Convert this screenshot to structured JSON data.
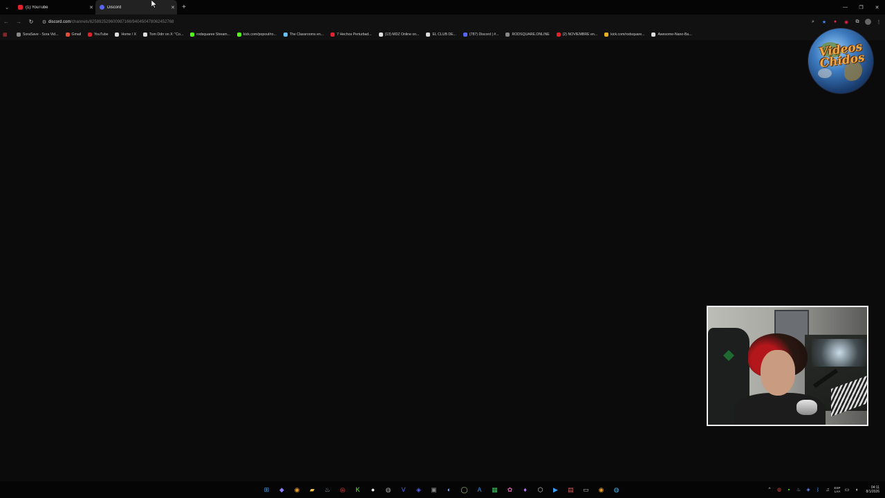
{
  "browser": {
    "tabs": [
      {
        "title": "(1) YouTube",
        "favicon": "youtube-icon",
        "active": false
      },
      {
        "title": "Discord",
        "favicon": "discord-icon",
        "active": true
      }
    ],
    "new_tab": "+",
    "address": {
      "host": "discord.com",
      "path": "/channels/625892529600987166/940450478062452768"
    },
    "bookmarks": [
      {
        "label": "SoraSave - Sora Vid...",
        "icon": "globe-icon",
        "color": "#888888"
      },
      {
        "label": "Gmail",
        "icon": "gmail-icon",
        "color": "#e24c3c"
      },
      {
        "label": "YouTube",
        "icon": "youtube-icon",
        "color": "#e0222a"
      },
      {
        "label": "Home / X",
        "icon": "x-icon",
        "color": "#dddddd"
      },
      {
        "label": "Tom Ddrr on X: \"Co...",
        "icon": "x-icon",
        "color": "#dddddd"
      },
      {
        "label": "rodsquaree Stream...",
        "icon": "kick-icon",
        "color": "#53fc18"
      },
      {
        "label": "kick.com/popout/ro...",
        "icon": "kick-icon",
        "color": "#53fc18"
      },
      {
        "label": "The Classrooms en...",
        "icon": "steam-icon",
        "color": "#66c0f4"
      },
      {
        "label": "7 Hechos Perturbad...",
        "icon": "youtube-icon",
        "color": "#e0222a"
      },
      {
        "label": "(13) MDZ Online on...",
        "icon": "x-icon",
        "color": "#dddddd"
      },
      {
        "label": "EL CLUB DE...",
        "icon": "x-icon",
        "color": "#dddddd"
      },
      {
        "label": "(787) Discord | #...",
        "icon": "discord-icon",
        "color": "#5865f2"
      },
      {
        "label": "RODSQUARE.ONLINE",
        "icon": "globe-icon",
        "color": "#888888"
      },
      {
        "label": "(2) NOVIEMBRE en...",
        "icon": "youtube-icon",
        "color": "#e0222a"
      },
      {
        "label": "kick.com/rodsquare...",
        "icon": "generic-icon",
        "color": "#e8b020"
      },
      {
        "label": "Awesome-Nano-Ba...",
        "icon": "github-icon",
        "color": "#dddddd"
      }
    ]
  },
  "overlay": {
    "logo_text": "Videos Chidos"
  },
  "taskbar": {
    "apps": [
      {
        "name": "windows-start-icon",
        "glyph": "⊞",
        "color": "#3ba0ff"
      },
      {
        "name": "copilot-icon",
        "glyph": "◆",
        "color": "#8a7dff"
      },
      {
        "name": "chrome-icon",
        "glyph": "◉",
        "color": "#e8a030"
      },
      {
        "name": "file-explorer-icon",
        "glyph": "▰",
        "color": "#f2c744"
      },
      {
        "name": "steam-icon",
        "glyph": "♨",
        "color": "#9ab"
      },
      {
        "name": "app-red-icon",
        "glyph": "◎",
        "color": "#e04040"
      },
      {
        "name": "kick-icon",
        "glyph": "K",
        "color": "#53fc18"
      },
      {
        "name": "app-white-icon",
        "glyph": "●",
        "color": "#eeeeee"
      },
      {
        "name": "app-gray-icon",
        "glyph": "◍",
        "color": "#aaaaaa"
      },
      {
        "name": "vegas-icon",
        "glyph": "V",
        "color": "#4a6bff"
      },
      {
        "name": "discord-icon",
        "glyph": "◈",
        "color": "#5865f2"
      },
      {
        "name": "app-box-icon",
        "glyph": "▣",
        "color": "#888"
      },
      {
        "name": "app-blue-circle-icon",
        "glyph": "◐",
        "color": "#8ab4f8"
      },
      {
        "name": "app-green-circle-icon",
        "glyph": "◯",
        "color": "#9c6"
      },
      {
        "name": "app-a-icon",
        "glyph": "A",
        "color": "#3a8edc"
      },
      {
        "name": "app-green-box-icon",
        "glyph": "▦",
        "color": "#3fbf5f"
      },
      {
        "name": "app-color-icon",
        "glyph": "✿",
        "color": "#e05ab0"
      },
      {
        "name": "app-gem-icon",
        "glyph": "♦",
        "color": "#c07aff"
      },
      {
        "name": "app-cube-icon",
        "glyph": "⬡",
        "color": "#cccccc"
      },
      {
        "name": "app-blue-icon",
        "glyph": "▶",
        "color": "#3aa0ff"
      },
      {
        "name": "app-photo-icon",
        "glyph": "▤",
        "color": "#d06060"
      },
      {
        "name": "terminal-icon",
        "glyph": "▭",
        "color": "#bbbbbb"
      },
      {
        "name": "chrome-2-icon",
        "glyph": "◉",
        "color": "#e8a030"
      },
      {
        "name": "app-globe-icon",
        "glyph": "◍",
        "color": "#4ab3e8"
      }
    ],
    "lang_top": "ESP",
    "lang_bottom": "LAA",
    "time": "04:11",
    "date": "8/1/2026"
  }
}
